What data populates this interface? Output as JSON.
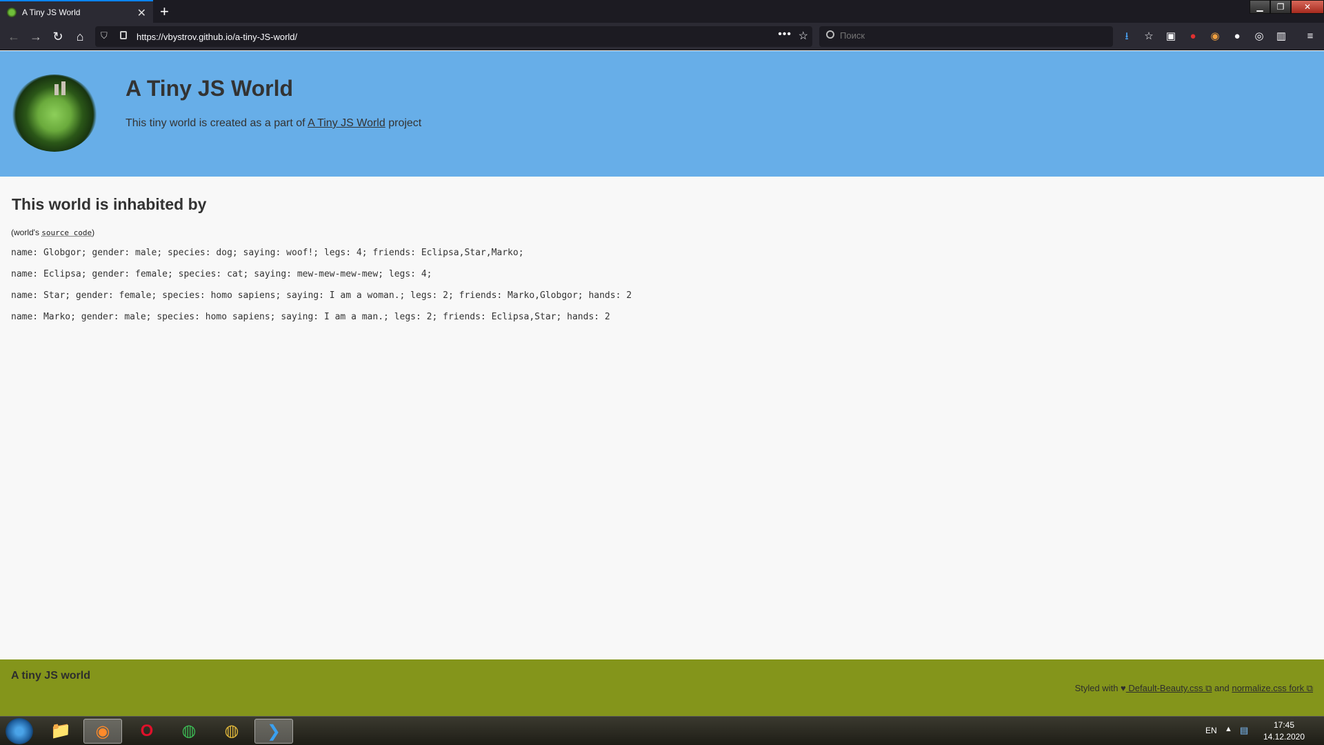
{
  "browser": {
    "tab_title": "A Tiny JS World",
    "new_tab_symbol": "+",
    "url": "https://vbystrov.github.io/a-tiny-JS-world/",
    "search_placeholder": "Поиск"
  },
  "header": {
    "title": "A Tiny JS World",
    "subtitle_prefix": "This tiny world is created as a part of ",
    "subtitle_link": "A Tiny JS World",
    "subtitle_suffix": " project"
  },
  "main": {
    "heading": "This world is inhabited by",
    "source_prefix": "(world's ",
    "source_link": "source code",
    "source_suffix": ")",
    "inhabitants": [
      "name: Globgor; gender: male; species: dog; saying: woof!; legs: 4; friends: Eclipsa,Star,Marko;",
      "name: Eclipsa; gender: female; species: cat; saying: mew-mew-mew-mew; legs: 4;",
      "name: Star; gender: female; species: homo sapiens; saying: I am a woman.; legs: 2; friends: Marko,Globgor; hands: 2",
      "name: Marko; gender: male; species: homo sapiens; saying: I am a man.; legs: 2; friends: Eclipsa,Star; hands: 2"
    ]
  },
  "footer": {
    "title": "A tiny JS world",
    "styled_with": "Styled with ",
    "heart": "♥",
    "link1": " Default-Beauty.css ⧉",
    "and": " and ",
    "link2": "normalize.css fork ⧉"
  },
  "taskbar": {
    "language": "EN",
    "time": "17:45",
    "date": "14.12.2020"
  },
  "colors": {
    "header_bg": "#67aee8",
    "footer_bg": "#84951b",
    "page_bg": "#f8f8f8"
  }
}
